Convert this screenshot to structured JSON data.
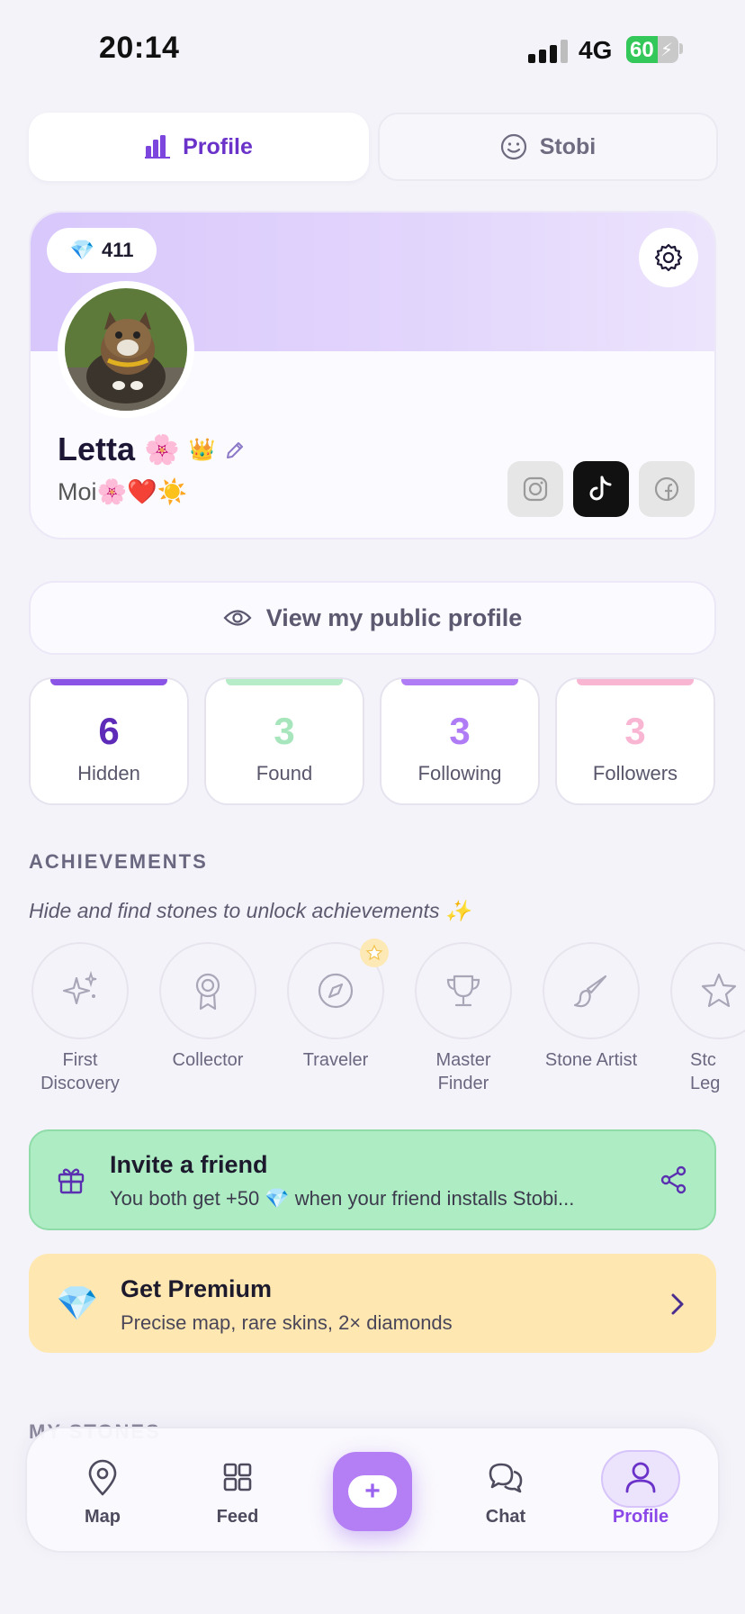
{
  "status_bar": {
    "time": "20:14",
    "network": "4G",
    "battery": "60",
    "battery_level": 0.6
  },
  "top_tabs": {
    "profile": "Profile",
    "stobi": "Stobi"
  },
  "profile": {
    "gems": "411",
    "name": "Letta",
    "name_emoji": "🌸",
    "crown": "👑",
    "bio": "Moi🌸❤️☀️"
  },
  "social": {
    "instagram": "instagram-icon",
    "tiktok": "tiktok-icon",
    "facebook": "facebook-icon"
  },
  "public_profile_label": "View my public profile",
  "stats": [
    {
      "value": "6",
      "label": "Hidden",
      "color": "#5e2ab8",
      "bar": "#8a55e6"
    },
    {
      "value": "3",
      "label": "Found",
      "color": "#a7e6bd",
      "bar": "#b6ecc7"
    },
    {
      "value": "3",
      "label": "Following",
      "color": "#b07cf6",
      "bar": "#b07cf6"
    },
    {
      "value": "3",
      "label": "Followers",
      "color": "#f9b6d3",
      "bar": "#f9b6d3"
    }
  ],
  "achievements": {
    "title": "ACHIEVEMENTS",
    "subtitle": "Hide and find stones to unlock achievements ✨",
    "items": [
      {
        "line1": "First",
        "line2": "Discovery"
      },
      {
        "line1": "Collector",
        "line2": ""
      },
      {
        "line1": "Traveler",
        "line2": ""
      },
      {
        "line1": "Master",
        "line2": "Finder"
      },
      {
        "line1": "Stone Artist",
        "line2": ""
      },
      {
        "line1": "Stc",
        "line2": "Leg"
      }
    ]
  },
  "invite": {
    "title": "Invite a friend",
    "subtitle": "You both get +50 💎 when your friend installs Stobi..."
  },
  "premium": {
    "title": "Get Premium",
    "subtitle": "Precise map, rare skins, 2× diamonds"
  },
  "my_stones_title": "MY STONES",
  "nav": {
    "map": "Map",
    "feed": "Feed",
    "chat": "Chat",
    "profile": "Profile",
    "add": "+"
  },
  "colors": {
    "accent": "#6a32c9",
    "invite_bg": "#aeedc3",
    "premium_bg": "#fee7b0"
  }
}
